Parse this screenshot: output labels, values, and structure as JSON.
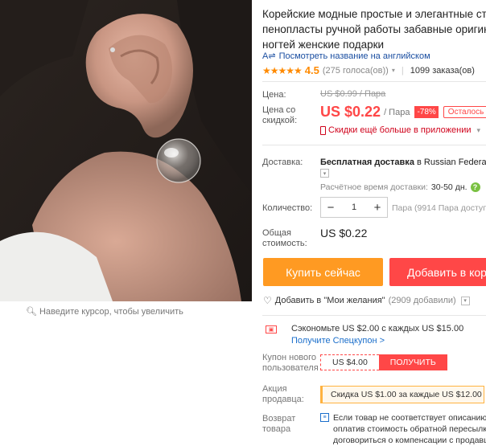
{
  "product": {
    "title_lines": [
      "Корейские модные простые и элегантные стекл",
      "пенопласты ручной работы забавные оригина",
      "ногтей женские подарки"
    ],
    "translate_link": "Посмотреть название на английском",
    "rating_value": "4.5",
    "votes": "(275 голоса(ов))",
    "orders": "1099 заказа(ов)"
  },
  "gallery": {
    "zoom_hint": "Наведите курсор, чтобы увеличить"
  },
  "price": {
    "label_price": "Цена:",
    "old_price": "US $0.99 / Пара",
    "label_discount_price": "Цена со скидкой:",
    "current_price": "US $0.22",
    "per_unit": "/ Пара",
    "discount": "-78%",
    "left_tag": "Осталось",
    "app_deal": "Скидки ещё больше в приложении"
  },
  "shipping": {
    "label": "Доставка:",
    "free_text": "Бесплатная доставка",
    "to_text": "в",
    "country": "Russian Federation",
    "time_label": "Расчётное время доставки:",
    "time_value": "30-50 дн."
  },
  "quantity": {
    "label": "Количество:",
    "value": "1",
    "available": "Пара (9914 Пара доступн"
  },
  "total": {
    "label": "Общая стоимость:",
    "value": "US $0.22"
  },
  "actions": {
    "buy_now": "Купить сейчас",
    "add_to_cart": "Добавить в кор",
    "wishlist": "Добавить в \"Мои желания\"",
    "wishlist_count": "(2909 добавили)"
  },
  "coupons": {
    "save_text": "Сэкономьте US $2.00 с каждых US $15.00",
    "get_coupon": "Получите Спецкупон >",
    "new_user_label": "Купон нового пользователя",
    "new_user_value": "US $4.00",
    "new_user_button": "ПОЛУЧИТЬ",
    "seller_label": "Акция продавца:",
    "seller_promo": "Скидка US $1.00 за каждые US $12.00"
  },
  "returns": {
    "label": "Возврат товара",
    "text_lines": [
      "Если товар не соответствует описанию,",
      "оплатив стоимость обратной пересылк",
      "договориться о компенсации с продавц"
    ]
  },
  "colors": {
    "price_red": "#ff4747",
    "buy_orange": "#ff9a22",
    "link_blue": "#1a4ea1",
    "star_orange": "#ff8a00"
  }
}
